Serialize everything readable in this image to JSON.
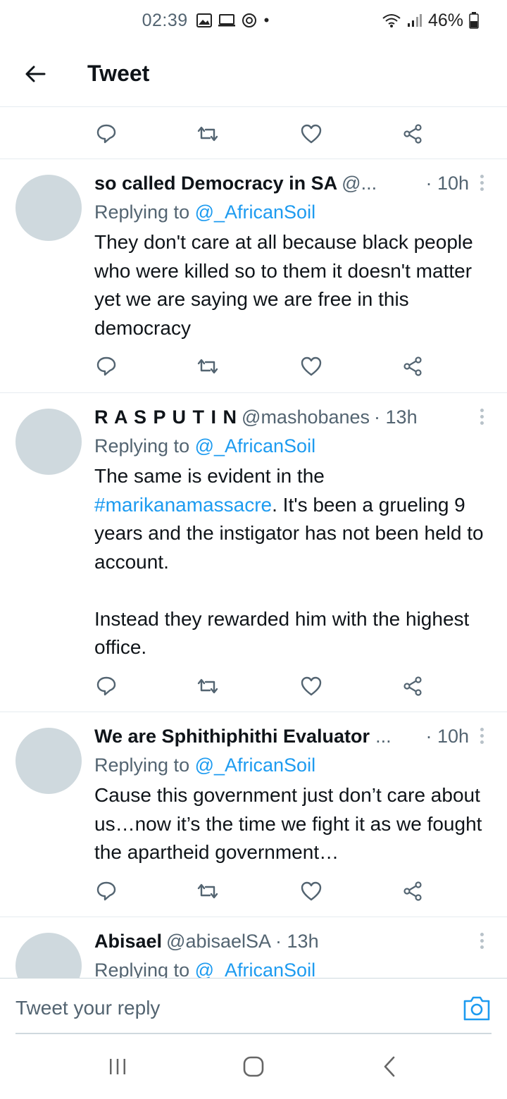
{
  "status": {
    "time": "02:39",
    "battery": "46%",
    "icons": [
      "gallery-icon",
      "screen-icon",
      "sync-icon",
      "dot-icon",
      "wifi-icon",
      "signal-icon",
      "battery-icon"
    ]
  },
  "header": {
    "title": "Tweet",
    "back_icon": "arrow-left-icon"
  },
  "tweets": [
    {
      "name": "so called Democracy in SA",
      "handle": "@...",
      "time": "· 10h",
      "replying_prefix": "Replying to ",
      "replying_to": "@_AfricanSoil",
      "text": "They don't care at all because black people who were killed so to them it doesn't matter yet we are saying we are free in this democracy"
    },
    {
      "name": "R A S P U T I N",
      "handle": "@mashobanes",
      "time": "· 13h",
      "replying_prefix": "Replying to ",
      "replying_to": "@_AfricanSoil",
      "text_before": "The same is evident in the\n",
      "hashtag": "#marikanamassacre",
      "text_after": ". It's been a grueling 9 years and the instigator has not been held to account.\n\nInstead they rewarded him with the highest office."
    },
    {
      "name": "We are Sphithiphithi Evaluator",
      "handle": "...",
      "time": "· 10h",
      "replying_prefix": "Replying to ",
      "replying_to": "@_AfricanSoil",
      "text": "Cause this government just don’t care about us…now it’s the time we fight it as we fought the apartheid government…"
    },
    {
      "name": "Abisael",
      "handle": "@abisaelSA",
      "time": "· 13h",
      "replying_prefix": "Replying to ",
      "replying_to": "@_AfricanSoil"
    }
  ],
  "compose": {
    "placeholder": "Tweet your reply"
  },
  "colors": {
    "accent": "#1d9bf0",
    "text": "#0f1419",
    "muted": "#536471",
    "avatar": "#cfd9de",
    "divider": "#e6ecf0"
  }
}
